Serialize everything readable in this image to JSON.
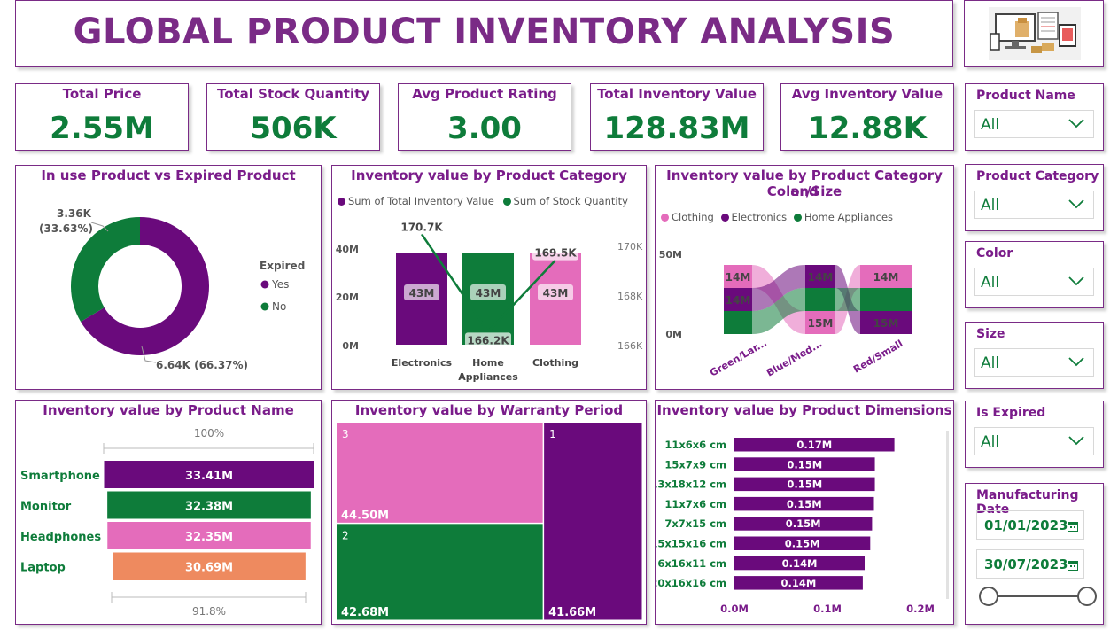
{
  "title": "GLOBAL PRODUCT INVENTORY ANALYSIS",
  "logo_icon": "inventory-devices-illustration",
  "colors": {
    "purple": "#6a0a7c",
    "green": "#0e7c3a",
    "pink": "#e46cbb",
    "orange": "#ee8a5f",
    "title": "#7a2b86"
  },
  "kpis": [
    {
      "label": "Total Price",
      "value": "2.55M"
    },
    {
      "label": "Total Stock Quantity",
      "value": "506K"
    },
    {
      "label": "Avg Product Rating",
      "value": "3.00"
    },
    {
      "label": "Total Inventory Value",
      "value": "128.83M"
    },
    {
      "label": "Avg Inventory Value",
      "value": "12.88K"
    }
  ],
  "slicers": {
    "product_name": {
      "label": "Product Name",
      "value": "All"
    },
    "product_category": {
      "label": "Product Category",
      "value": "All"
    },
    "color": {
      "label": "Color",
      "value": "All"
    },
    "size": {
      "label": "Size",
      "value": "All"
    },
    "is_expired": {
      "label": "Is Expired",
      "value": "All"
    },
    "manufacturing_date": {
      "label": "Manufacturing Date",
      "start": "01/01/2023",
      "end": "30/07/2023"
    }
  },
  "chart_data": [
    {
      "id": "donut",
      "type": "pie",
      "title": "In use Product vs Expired Product",
      "legend_title": "Expired",
      "legend_position": "right",
      "slices": [
        {
          "name": "Yes",
          "value": 6640,
          "label": "6.64K (66.37%)",
          "color": "#6a0a7c"
        },
        {
          "name": "No",
          "value": 3360,
          "label_line1": "3.36K",
          "label_line2": "(33.63%)",
          "color": "#0e7c3a"
        }
      ]
    },
    {
      "id": "category_combo",
      "type": "bar",
      "title": "Inventory value by Product Category",
      "legend": [
        "Sum of Total Inventory Value",
        "Sum of Stock Quantity"
      ],
      "categories": [
        "Electronics",
        "Home Appliances",
        "Clothing"
      ],
      "category_labels": [
        [
          "Electronics"
        ],
        [
          "Home",
          "Appliances"
        ],
        [
          "Clothing"
        ]
      ],
      "bar_colors": [
        "#6a0a7c",
        "#0e7c3a",
        "#e46cbb"
      ],
      "bar_values": [
        43,
        43,
        43
      ],
      "bar_labels": [
        "43M",
        "43M",
        "43M"
      ],
      "y_ticks": [
        "0M",
        "20M",
        "40M"
      ],
      "ylim": [
        0,
        48
      ],
      "line_values": [
        170.7,
        166.2,
        169.5
      ],
      "line_labels": [
        "170.7K",
        "166.2K",
        "169.5K"
      ],
      "y2_ticks": [
        "166K",
        "168K",
        "170K"
      ],
      "y2lim": [
        165.6,
        171.0
      ]
    },
    {
      "id": "ribbon",
      "type": "bar",
      "title_line1": "Inventory value by Product Category and",
      "title_line2": "Color/Size",
      "legend": [
        "Clothing",
        "Electronics",
        "Home Appliances"
      ],
      "categories": [
        "Green/Lar...",
        "Blue/Med...",
        "Red/Small"
      ],
      "y_ticks": [
        "0M",
        "50M"
      ],
      "series": [
        {
          "name": "Clothing",
          "color": "#e46cbb",
          "values": [
            14,
            15,
            14
          ],
          "labels": [
            "14M",
            "15M",
            "14M"
          ]
        },
        {
          "name": "Electronics",
          "color": "#6a0a7c",
          "values": [
            14,
            14,
            15
          ],
          "labels": [
            "14M",
            "14M",
            "15M"
          ]
        },
        {
          "name": "Home Appliances",
          "color": "#0e7c3a",
          "values": [
            14,
            14,
            14
          ],
          "labels": [
            "",
            "",
            ""
          ]
        }
      ],
      "stack_order": [
        [
          "Home Appliances",
          "Electronics",
          "Clothing"
        ],
        [
          "Clothing",
          "Home Appliances",
          "Electronics"
        ],
        [
          "Electronics",
          "Home Appliances",
          "Clothing"
        ]
      ]
    },
    {
      "id": "funnel",
      "type": "bar",
      "title": "Inventory value by Product Name",
      "top_pct": "100%",
      "bottom_pct": "91.8%",
      "categories": [
        "Smartphone",
        "Monitor",
        "Headphones",
        "Laptop"
      ],
      "values": [
        33.41,
        32.38,
        32.35,
        30.69
      ],
      "labels": [
        "33.41M",
        "32.38M",
        "32.35M",
        "30.69M"
      ],
      "colors": [
        "#6a0a7c",
        "#0e7c3a",
        "#e46cbb",
        "#ee8a5f"
      ]
    },
    {
      "id": "treemap",
      "type": "heatmap",
      "title": "Inventory value by Warranty Period",
      "cells": [
        {
          "name": "3",
          "value": 44.5,
          "label": "44.50M",
          "color": "#e46cbb"
        },
        {
          "name": "2",
          "value": 42.68,
          "label": "42.68M",
          "color": "#0e7c3a"
        },
        {
          "name": "1",
          "value": 41.66,
          "label": "41.66M",
          "color": "#6a0a7c"
        }
      ]
    },
    {
      "id": "dimensions",
      "type": "bar",
      "title": "Inventory value by Product Dimensions",
      "categories": [
        "11x6x6 cm",
        "15x7x9 cm",
        "13x18x12 cm",
        "11x7x6 cm",
        "7x7x15 cm",
        "15x15x16 cm",
        "6x16x11 cm",
        "20x16x16 cm"
      ],
      "values": [
        0.172,
        0.151,
        0.151,
        0.15,
        0.148,
        0.146,
        0.14,
        0.138
      ],
      "labels": [
        "0.17M",
        "0.15M",
        "0.15M",
        "0.15M",
        "0.15M",
        "0.15M",
        "0.14M",
        "0.14M"
      ],
      "x_ticks": [
        "0.0M",
        "0.1M",
        "0.2M"
      ],
      "xlim": [
        0,
        0.2
      ],
      "color": "#6a0a7c"
    }
  ]
}
